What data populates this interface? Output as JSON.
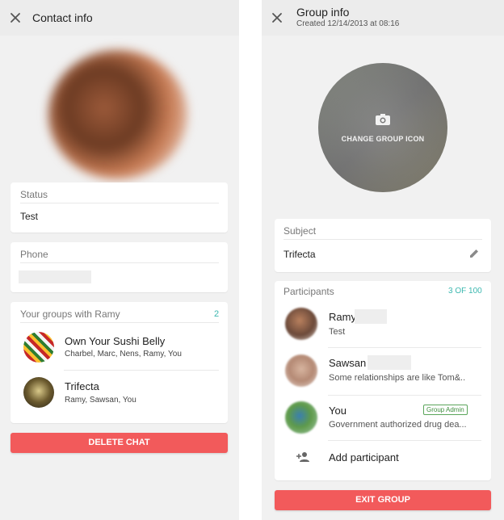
{
  "contact": {
    "header_title": "Contact info",
    "status_label": "Status",
    "status_value": "Test",
    "phone_label": "Phone",
    "groups_label": "Your groups with Ramy",
    "groups_count": "2",
    "groups": [
      {
        "name": "Own Your Sushi Belly",
        "members": "Charbel, Marc, Nens, Ramy, You"
      },
      {
        "name": "Trifecta",
        "members": "Ramy, Sawsan, You"
      }
    ],
    "delete_label": "DELETE CHAT"
  },
  "group": {
    "header_title": "Group info",
    "header_sub": "Created 12/14/2013 at 08:16",
    "change_icon_label": "CHANGE GROUP ICON",
    "subject_label": "Subject",
    "subject_value": "Trifecta",
    "participants_label": "Participants",
    "participants_count": "3 OF 100",
    "participants": [
      {
        "name": "Ramy",
        "status": "Test"
      },
      {
        "name": "Sawsan",
        "status": "Some relationships are like Tom&.."
      },
      {
        "name": "You",
        "status": "Government authorized drug dea...",
        "badge": "Group Admin"
      }
    ],
    "add_participant_label": "Add participant",
    "exit_label": "EXIT GROUP"
  },
  "colors": {
    "danger": "#f25a5b",
    "teal": "#3db8b0",
    "admin_green": "#3e8e3e"
  },
  "icons": [
    "close-icon",
    "camera-icon",
    "pencil-icon",
    "add-person-icon"
  ]
}
